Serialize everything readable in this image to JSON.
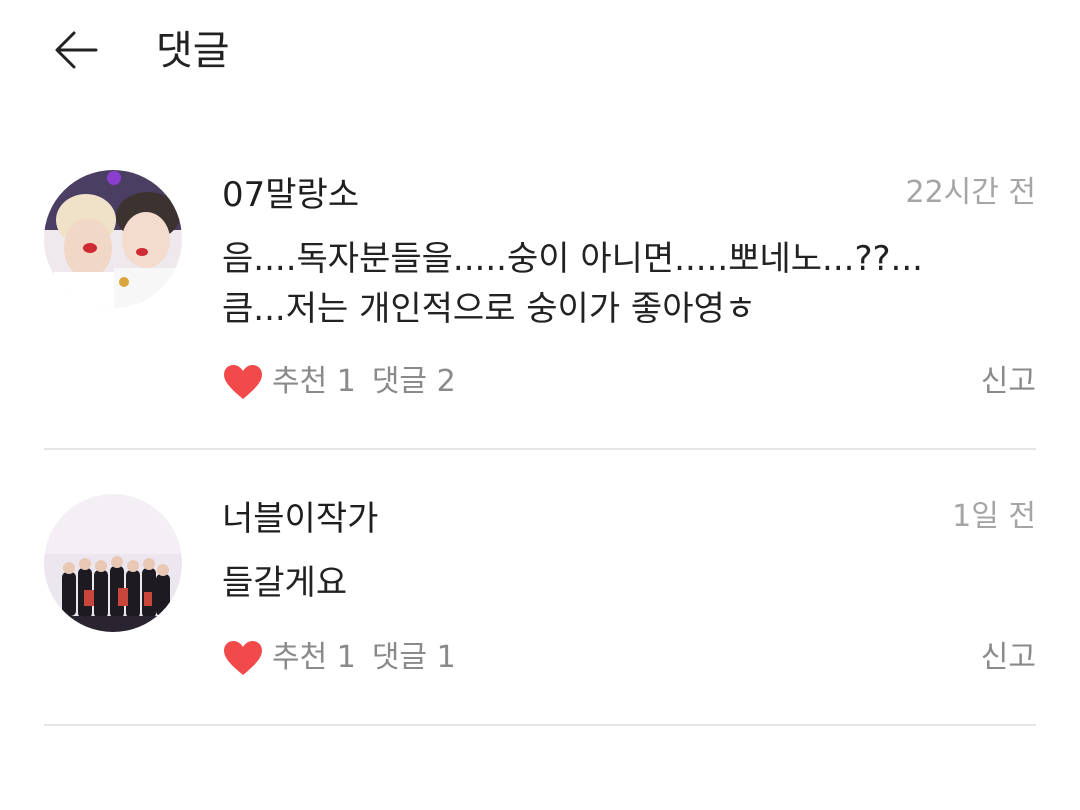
{
  "header": {
    "title": "댓글"
  },
  "comments": [
    {
      "author": "07말랑소",
      "time": "22시간 전",
      "text": "음....독자분들을.....숭이 아니면.....뽀네노...??...\n큼...저는 개인적으로 숭이가 좋아영ㅎ",
      "like_label": "추천 1",
      "reply_label": "댓글 2",
      "report_label": "신고"
    },
    {
      "author": "너블이작가",
      "time": "1일 전",
      "text": "들갈게요",
      "like_label": "추천 1",
      "reply_label": "댓글 1",
      "report_label": "신고"
    }
  ],
  "colors": {
    "heart": "#f24a4a",
    "muted": "#8a8a8a",
    "timestamp": "#a5a5a5",
    "divider": "#e6e6e6"
  },
  "icons": {
    "back": "arrow-left-icon",
    "like": "heart-icon"
  }
}
